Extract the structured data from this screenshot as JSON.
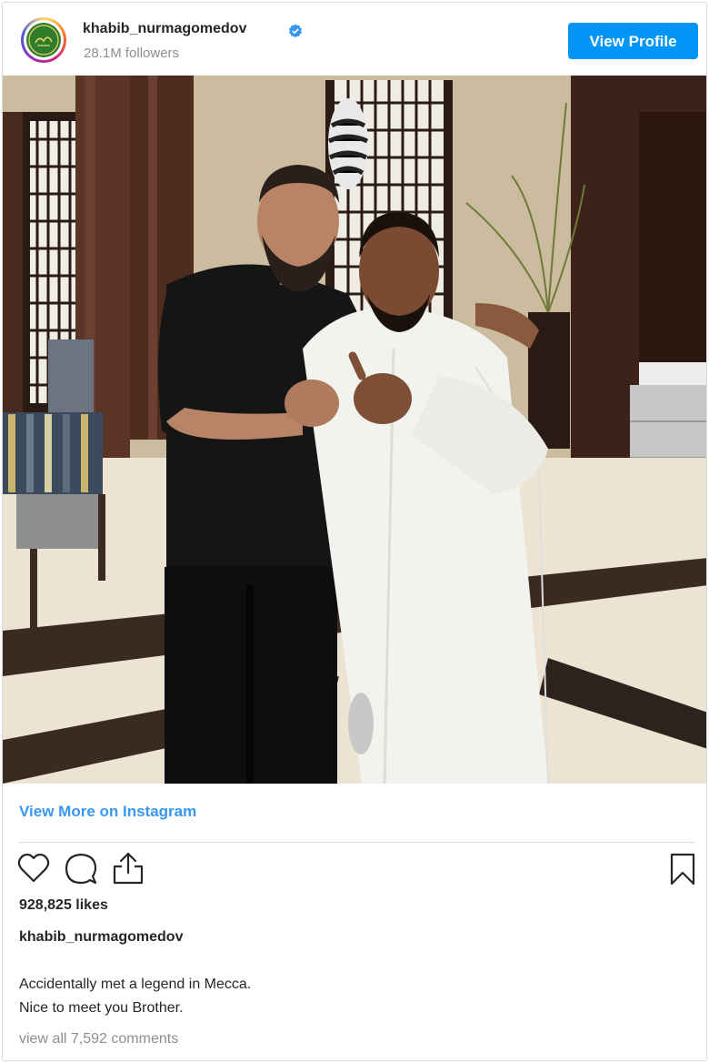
{
  "header": {
    "username": "khabib_nurmagomedov",
    "followers": "28.1M followers",
    "view_profile_label": "View Profile"
  },
  "post": {
    "view_more_label": "View More on Instagram",
    "likes": "928,825 likes",
    "caption_user": "khabib_nurmagomedov",
    "caption_line1": "Accidentally met a legend in Mecca.",
    "caption_line2": "Nice to meet you Brother.",
    "comments_link": "view all 7,592 comments"
  },
  "colors": {
    "button_blue": "#0095f6",
    "link_blue": "#3897f0",
    "verified_blue": "#3897f0",
    "muted_text": "#8e8e8e"
  },
  "icons": [
    "verified-badge-icon",
    "heart-icon",
    "comment-icon",
    "share-icon",
    "bookmark-icon"
  ]
}
